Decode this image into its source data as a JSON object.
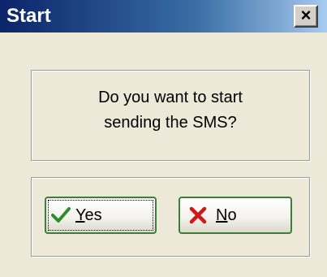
{
  "window": {
    "title": "Start",
    "close_glyph": "×"
  },
  "message": {
    "line1": "Do you want to start",
    "line2": "sending the SMS?"
  },
  "buttons": {
    "yes": {
      "mnemonic": "Y",
      "rest": "es",
      "icon": "checkmark-icon"
    },
    "no": {
      "mnemonic": "N",
      "rest": "o",
      "icon": "cross-icon"
    }
  },
  "colors": {
    "title_bar_start": "#0a246a",
    "title_bar_end": "#a6caf0",
    "dialog_bg": "#ece9d8",
    "button_border": "#3e7d3a",
    "check_green": "#2e8b2e",
    "cross_red": "#d01818"
  }
}
